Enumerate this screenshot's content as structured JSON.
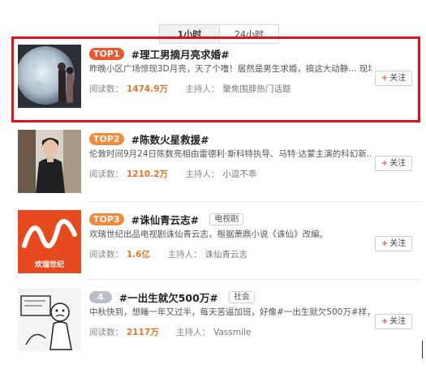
{
  "tabs": [
    {
      "label": "1小时",
      "active": true
    },
    {
      "label": "24小时",
      "active": false
    }
  ],
  "items": [
    {
      "rank": "TOP1",
      "title": "#理工男摘月亮求婚#",
      "tag": "",
      "desc": "昨晚小区广场惊现3D月亮，天了个噜！居然是男生求婚，搞这大动静... 现场...",
      "read_label": "阅读数：",
      "read_count": "1474.9万",
      "host_label": "主持人：",
      "host_name": "聚焦围脖热门话题",
      "follow_label": "关注",
      "thumb_icon": "moon-proposal-photo"
    },
    {
      "rank": "TOP2",
      "title": "#陈数火星救援#",
      "tag": "",
      "desc": "伦敦时间9月24日陈数亮相由雷德利·斯科特执导、马特·达蒙主演的科幻新...",
      "read_label": "阅读数：",
      "read_count": "1210.2万",
      "host_label": "主持人：",
      "host_name": "小逗不乖",
      "follow_label": "关注",
      "thumb_icon": "woman-portrait-photo"
    },
    {
      "rank": "TOP3",
      "title": "#诛仙青云志#",
      "tag": "电视剧",
      "desc": "欢瑞世纪出品电视剧诛仙青云志，根据萧鼎小说《诛仙》改编。",
      "read_label": "阅读数：",
      "read_count": "1.6亿",
      "host_label": "主持人：",
      "host_name": "诛仙青云志",
      "follow_label": "关注",
      "thumb_icon": "huanrui-logo",
      "logo_text": "欢瑞世纪"
    },
    {
      "rank": "4",
      "title": "#一出生就欠500万#",
      "tag": "社会",
      "desc": "中秋快到，想睡一年又过半，每天苦逼加班，好像#一出生就欠500万#样，...",
      "read_label": "阅读数：",
      "read_count": "2117万",
      "host_label": "主持人：",
      "host_name": "Vassmile",
      "follow_label": "关注",
      "thumb_icon": "cartoon-sketch"
    }
  ],
  "colors": {
    "highlight_border": "#e4101c",
    "rank_red": "#f0562e",
    "rank_orange": "#f5883b",
    "rank_gray": "#b9bec9",
    "count_orange": "#e8732a"
  }
}
